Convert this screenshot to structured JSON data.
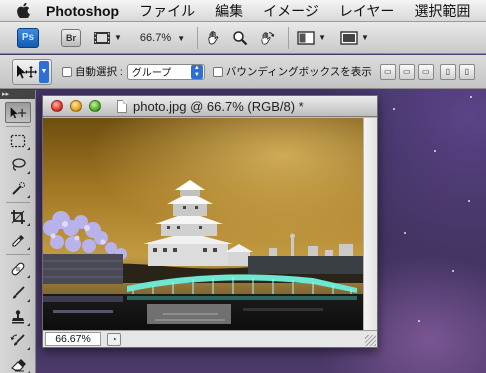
{
  "menubar": {
    "apple_icon": "apple-icon",
    "app_name": "Photoshop",
    "items": [
      "ファイル",
      "編集",
      "イメージ",
      "レイヤー",
      "選択範囲"
    ]
  },
  "appbar": {
    "ps_label": "Ps",
    "br_label": "Br",
    "zoom": "66.7%",
    "icons": [
      "screen-mode-icon",
      "hand-icon",
      "zoom-icon",
      "rotate-view-icon",
      "arrange-documents-icon",
      "screen-mode-icon"
    ]
  },
  "options": {
    "auto_select_label": "自動選択 :",
    "auto_select_value": "グループ",
    "bounding_box_label": "バウンディングボックスを表示",
    "auto_select_checked": false,
    "bounding_box_checked": false
  },
  "tools": {
    "header": "▸▸",
    "items": [
      "move-tool-icon",
      "marquee-tool-icon",
      "lasso-tool-icon",
      "quick-selection-tool-icon",
      "crop-tool-icon",
      "eyedropper-tool-icon",
      "healing-brush-tool-icon",
      "brush-tool-icon",
      "clone-stamp-tool-icon",
      "history-brush-tool-icon",
      "eraser-tool-icon"
    ]
  },
  "document": {
    "title": "photo.jpg @ 66.7% (RGB/8) *",
    "zoom_field": "66.67%"
  },
  "colors": {
    "accent": "#2f6fd4",
    "close": "#e2382a",
    "minimize": "#e8a320",
    "zoom": "#50b02c"
  }
}
